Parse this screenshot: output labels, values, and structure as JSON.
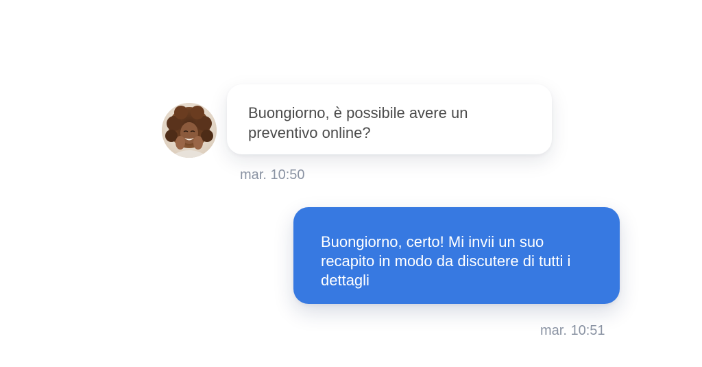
{
  "conversation": {
    "messages": [
      {
        "direction": "incoming",
        "text": "Buongiorno, è possibile avere un preventivo online?",
        "time": "mar. 10:50",
        "has_avatar": true
      },
      {
        "direction": "outgoing",
        "text": "Buongiorno, certo! Mi invii un suo recapito in modo da discutere di tutti i dettagli",
        "time": "mar. 10:51"
      }
    ]
  },
  "colors": {
    "page_background": "#ffffff",
    "incoming_bubble": "#ffffff",
    "incoming_text": "#4b4b4b",
    "outgoing_bubble": "#3779e1",
    "outgoing_text": "#ffffff",
    "timestamp_text": "#8a93a3"
  },
  "icons": {
    "avatar": "user-photo-avatar"
  }
}
